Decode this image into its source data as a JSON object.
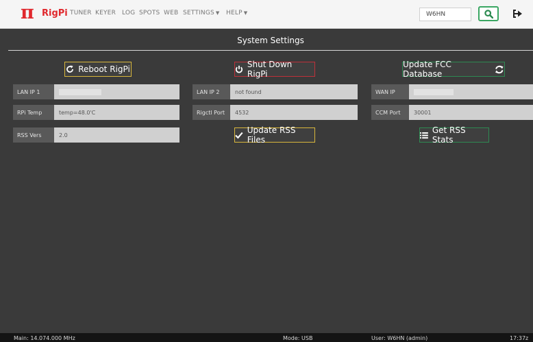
{
  "brand": {
    "symbol": "π",
    "name": "RigPi"
  },
  "nav": {
    "items": [
      "TUNER",
      "KEYER",
      "LOG",
      "SPOTS",
      "WEB"
    ],
    "settings": "SETTINGS",
    "help": "HELP"
  },
  "header": {
    "callsign_value": "W6HN",
    "search_icon": "search-icon",
    "logout_icon": "logout-icon"
  },
  "page": {
    "title": "System Settings"
  },
  "buttons": {
    "reboot": "Reboot RigPi",
    "shutdown": "Shut Down RigPi",
    "update_fcc": "Update FCC Database",
    "update_rss": "Update RSS Files",
    "get_rss_stats": "Get RSS Stats"
  },
  "fields": {
    "lan_ip1": {
      "label": "LAN IP 1",
      "value": ""
    },
    "lan_ip2": {
      "label": "LAN IP 2",
      "value": "not found"
    },
    "wan_ip": {
      "label": "WAN IP",
      "value": ""
    },
    "rpi_temp": {
      "label": "RPi Temp",
      "value": "temp=48.0'C"
    },
    "rigctl_port": {
      "label": "Rigctl Port",
      "value": "4532"
    },
    "ccm_port": {
      "label": "CCM Port",
      "value": "30001"
    },
    "rss_vers": {
      "label": "RSS Vers",
      "value": "2.0"
    }
  },
  "status": {
    "main": "Main: 14.074.000 MHz",
    "mode": "Mode: USB",
    "user": "User: W6HN (admin)",
    "time": "17:37z"
  },
  "colors": {
    "brand": "#e0282d",
    "yellow": "#d9b73c",
    "red": "#c0303a",
    "green": "#2e8a52"
  }
}
